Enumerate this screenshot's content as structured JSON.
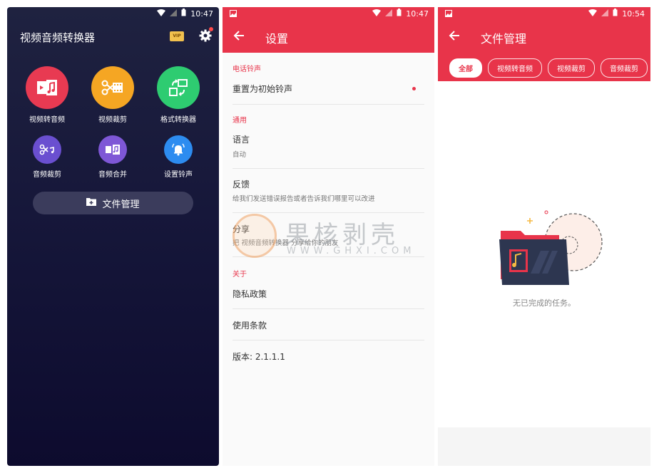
{
  "panel1": {
    "status_time": "10:47",
    "title": "视频音频转换器",
    "vip_label": "VIP",
    "tools": [
      {
        "label": "视频转音频",
        "color": "#e83a52",
        "icon": "video-music-icon"
      },
      {
        "label": "视频裁剪",
        "color": "#f5a623",
        "icon": "scissors-film-icon"
      },
      {
        "label": "格式转换器",
        "color": "#2ecc71",
        "icon": "convert-arrows-icon"
      },
      {
        "label": "音频裁剪",
        "color": "#6a4fd0",
        "icon": "audio-scissors-icon"
      },
      {
        "label": "音频合并",
        "color": "#7e57d6",
        "icon": "audio-merge-icon"
      },
      {
        "label": "设置铃声",
        "color": "#2d8cf0",
        "icon": "bell-icon"
      }
    ],
    "file_button": "文件管理"
  },
  "panel2": {
    "status_time": "10:47",
    "title": "设置",
    "sections": {
      "ringtone": "电话铃声",
      "general": "通用",
      "about": "关于"
    },
    "reset_ringtone": "重置为初始铃声",
    "language_title": "语言",
    "language_value": "自动",
    "feedback_title": "反馈",
    "feedback_sub": "给我们发送错误报告或者告诉我们哪里可以改进",
    "share_title": "分享",
    "share_sub": "把 视频音频转换器 分享给你的朋友",
    "privacy": "隐私政策",
    "terms": "使用条款",
    "version": "版本: 2.1.1.1",
    "watermark_text": "果核剥壳",
    "watermark_url": "WWW.GHXI.COM"
  },
  "panel3": {
    "status_time": "10:54",
    "title": "文件管理",
    "chips": [
      "全部",
      "视频转音频",
      "视频裁剪",
      "音频裁剪"
    ],
    "empty_message": "无已完成的任务。"
  }
}
